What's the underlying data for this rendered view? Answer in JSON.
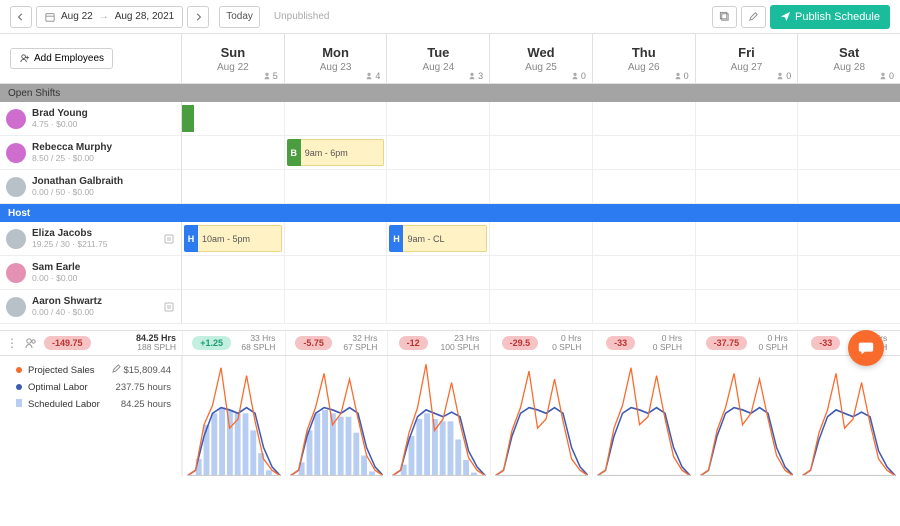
{
  "toolbar": {
    "range_start": "Aug 22",
    "range_end": "Aug 28, 2021",
    "today_label": "Today",
    "status": "Unpublished",
    "publish_label": "Publish Schedule"
  },
  "sidebar": {
    "add_employees_label": "Add Employees"
  },
  "days": [
    {
      "name": "Sun",
      "date": "Aug 22",
      "count": "5"
    },
    {
      "name": "Mon",
      "date": "Aug 23",
      "count": "4"
    },
    {
      "name": "Tue",
      "date": "Aug 24",
      "count": "3"
    },
    {
      "name": "Wed",
      "date": "Aug 25",
      "count": "0"
    },
    {
      "name": "Thu",
      "date": "Aug 26",
      "count": "0"
    },
    {
      "name": "Fri",
      "date": "Aug 27",
      "count": "0"
    },
    {
      "name": "Sat",
      "date": "Aug 28",
      "count": "0"
    }
  ],
  "sections": {
    "open_shifts": "Open Shifts",
    "host": "Host"
  },
  "employees": [
    {
      "name": "Brad Young",
      "meta": "4.75 · $0.00",
      "avatar": "pink"
    },
    {
      "name": "Rebecca Murphy",
      "meta": "8.50 / 25 · $0.00",
      "avatar": "pink"
    },
    {
      "name": "Jonathan Galbraith",
      "meta": "0.00 / 50 · $0.00",
      "avatar": "grey"
    },
    {
      "name": "Eliza Jacobs",
      "meta": "19.25 / 30 · $211.75",
      "avatar": "grey",
      "note": true
    },
    {
      "name": "Sam Earle",
      "meta": "0.00 · $0.00",
      "avatar": "pink2"
    },
    {
      "name": "Aaron Shwartz",
      "meta": "0.00 / 40 · $0.00",
      "avatar": "grey",
      "note": true
    }
  ],
  "shifts": {
    "rebecca_mon": {
      "tag": "B",
      "label": "9am - 6pm"
    },
    "eliza_sun": {
      "tag": "H",
      "label": "10am - 5pm"
    },
    "eliza_tue": {
      "tag": "H",
      "label": "9am - CL"
    }
  },
  "totals": {
    "week_pill": "-149.75",
    "week_hours": "84.25 Hrs",
    "week_splh": "188 SPLH"
  },
  "day_stats": [
    {
      "pill": "+1.25",
      "pill_color": "green",
      "hrs": "33 Hrs",
      "splh": "68 SPLH"
    },
    {
      "pill": "-5.75",
      "pill_color": "red",
      "hrs": "32 Hrs",
      "splh": "67 SPLH"
    },
    {
      "pill": "-12",
      "pill_color": "red",
      "hrs": "23 Hrs",
      "splh": "100 SPLH"
    },
    {
      "pill": "-29.5",
      "pill_color": "red",
      "hrs": "0 Hrs",
      "splh": "0 SPLH"
    },
    {
      "pill": "-33",
      "pill_color": "red",
      "hrs": "0 Hrs",
      "splh": "0 SPLH"
    },
    {
      "pill": "-37.75",
      "pill_color": "red",
      "hrs": "0 Hrs",
      "splh": "0 SPLH"
    },
    {
      "pill": "-33",
      "pill_color": "red",
      "hrs": "0 Hrs",
      "splh": "0 SPLH"
    }
  ],
  "legend": {
    "projected_sales": {
      "label": "Projected Sales",
      "value": "$15,809.44",
      "color": "#f96b2d"
    },
    "optimal_labor": {
      "label": "Optimal Labor",
      "value": "237.75 hours",
      "color": "#3b5bb5"
    },
    "scheduled_labor": {
      "label": "Scheduled Labor",
      "value": "84.25 hours",
      "color": "#b8cdf2"
    }
  },
  "chart_data": {
    "type": "line",
    "note": "Seven small daily charts. X axis = hour of day (approx 6am–midnight). Projected Sales (orange) and Optimal Labor (blue) are lines; Scheduled Labor (light blue bars) only present on days with scheduled hours. Values below are approximate normalized heights 0–1 read from the image.",
    "days": [
      {
        "name": "Sun",
        "projected": [
          0,
          0.05,
          0.45,
          0.62,
          0.95,
          0.42,
          0.5,
          0.88,
          0.48,
          0.15,
          0.05,
          0
        ],
        "optimal": [
          0,
          0.05,
          0.35,
          0.55,
          0.6,
          0.58,
          0.55,
          0.6,
          0.55,
          0.25,
          0.08,
          0
        ],
        "scheduled": [
          0,
          0.15,
          0.45,
          0.55,
          0.6,
          0.58,
          0.55,
          0.55,
          0.4,
          0.2,
          0.05,
          0
        ]
      },
      {
        "name": "Mon",
        "projected": [
          0,
          0.05,
          0.4,
          0.6,
          0.9,
          0.45,
          0.55,
          0.85,
          0.5,
          0.18,
          0.05,
          0
        ],
        "optimal": [
          0,
          0.05,
          0.35,
          0.55,
          0.6,
          0.58,
          0.55,
          0.6,
          0.55,
          0.25,
          0.08,
          0
        ],
        "scheduled": [
          0,
          0.12,
          0.4,
          0.55,
          0.58,
          0.55,
          0.52,
          0.52,
          0.38,
          0.18,
          0.04,
          0
        ]
      },
      {
        "name": "Tue",
        "projected": [
          0,
          0.05,
          0.38,
          0.6,
          0.98,
          0.4,
          0.5,
          0.82,
          0.46,
          0.16,
          0.05,
          0
        ],
        "optimal": [
          0,
          0.05,
          0.32,
          0.52,
          0.58,
          0.55,
          0.52,
          0.56,
          0.52,
          0.22,
          0.08,
          0
        ],
        "scheduled": [
          0,
          0.1,
          0.35,
          0.5,
          0.55,
          0.5,
          0.48,
          0.48,
          0.32,
          0.14,
          0.03,
          0
        ]
      },
      {
        "name": "Wed",
        "projected": [
          0,
          0.05,
          0.4,
          0.6,
          0.92,
          0.42,
          0.5,
          0.85,
          0.48,
          0.15,
          0.05,
          0
        ],
        "optimal": [
          0,
          0.05,
          0.35,
          0.55,
          0.6,
          0.58,
          0.55,
          0.6,
          0.55,
          0.25,
          0.08,
          0
        ],
        "scheduled": []
      },
      {
        "name": "Thu",
        "projected": [
          0,
          0.05,
          0.42,
          0.62,
          0.95,
          0.45,
          0.52,
          0.88,
          0.5,
          0.17,
          0.05,
          0
        ],
        "optimal": [
          0,
          0.05,
          0.35,
          0.55,
          0.6,
          0.58,
          0.55,
          0.6,
          0.55,
          0.25,
          0.08,
          0
        ],
        "scheduled": []
      },
      {
        "name": "Fri",
        "projected": [
          0,
          0.05,
          0.4,
          0.6,
          0.9,
          0.45,
          0.55,
          0.85,
          0.5,
          0.18,
          0.05,
          0
        ],
        "optimal": [
          0,
          0.05,
          0.35,
          0.55,
          0.6,
          0.58,
          0.55,
          0.6,
          0.55,
          0.25,
          0.08,
          0
        ],
        "scheduled": []
      },
      {
        "name": "Sat",
        "projected": [
          0,
          0.05,
          0.38,
          0.58,
          0.9,
          0.42,
          0.5,
          0.82,
          0.46,
          0.15,
          0.05,
          0
        ],
        "optimal": [
          0,
          0.05,
          0.32,
          0.52,
          0.58,
          0.55,
          0.52,
          0.56,
          0.52,
          0.22,
          0.08,
          0
        ],
        "scheduled": []
      }
    ]
  }
}
